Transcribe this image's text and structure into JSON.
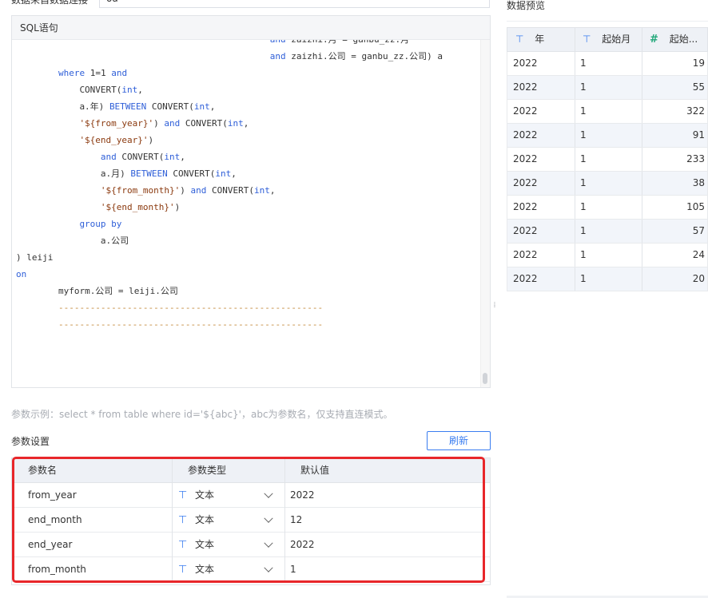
{
  "top_row": {
    "label": "数据来自数据连接",
    "selected_connection": "oa"
  },
  "sql_panel": {
    "title": "SQL语句",
    "lines": [
      {
        "indent": 48,
        "parts": [
          {
            "t": "and",
            "c": "kw"
          },
          {
            "t": " zaizhi.月 = ganbu_zz.月",
            "c": ""
          }
        ]
      },
      {
        "indent": 48,
        "parts": [
          {
            "t": "and",
            "c": "kw"
          },
          {
            "t": " zaizhi.公司 = ganbu_zz.公司) a",
            "c": ""
          }
        ]
      },
      {
        "indent": 8,
        "parts": [
          {
            "t": "where",
            "c": "kw"
          },
          {
            "t": " 1=1 ",
            "c": ""
          },
          {
            "t": "and",
            "c": "kw"
          }
        ]
      },
      {
        "indent": 12,
        "parts": [
          {
            "t": "CONVERT(",
            "c": ""
          },
          {
            "t": "int",
            "c": "kw"
          },
          {
            "t": ",",
            "c": ""
          }
        ]
      },
      {
        "indent": 12,
        "parts": [
          {
            "t": "a.年) ",
            "c": ""
          },
          {
            "t": "BETWEEN",
            "c": "kw"
          },
          {
            "t": " CONVERT(",
            "c": ""
          },
          {
            "t": "int",
            "c": "kw"
          },
          {
            "t": ",",
            "c": ""
          }
        ]
      },
      {
        "indent": 12,
        "parts": [
          {
            "t": "'${from_year}'",
            "c": "str"
          },
          {
            "t": ") ",
            "c": ""
          },
          {
            "t": "and",
            "c": "kw"
          },
          {
            "t": " CONVERT(",
            "c": ""
          },
          {
            "t": "int",
            "c": "kw"
          },
          {
            "t": ",",
            "c": ""
          }
        ]
      },
      {
        "indent": 12,
        "parts": [
          {
            "t": "'${end_year}'",
            "c": "str"
          },
          {
            "t": ")",
            "c": ""
          }
        ]
      },
      {
        "indent": 16,
        "parts": [
          {
            "t": "and",
            "c": "kw"
          },
          {
            "t": " CONVERT(",
            "c": ""
          },
          {
            "t": "int",
            "c": "kw"
          },
          {
            "t": ",",
            "c": ""
          }
        ]
      },
      {
        "indent": 16,
        "parts": [
          {
            "t": "a.月) ",
            "c": ""
          },
          {
            "t": "BETWEEN",
            "c": "kw"
          },
          {
            "t": " CONVERT(",
            "c": ""
          },
          {
            "t": "int",
            "c": "kw"
          },
          {
            "t": ",",
            "c": ""
          }
        ]
      },
      {
        "indent": 16,
        "parts": [
          {
            "t": "'${from_month}'",
            "c": "str"
          },
          {
            "t": ") ",
            "c": ""
          },
          {
            "t": "and",
            "c": "kw"
          },
          {
            "t": " CONVERT(",
            "c": ""
          },
          {
            "t": "int",
            "c": "kw"
          },
          {
            "t": ",",
            "c": ""
          }
        ]
      },
      {
        "indent": 16,
        "parts": [
          {
            "t": "'${end_month}'",
            "c": "str"
          },
          {
            "t": ")",
            "c": ""
          }
        ]
      },
      {
        "indent": 12,
        "parts": [
          {
            "t": "group by",
            "c": "kw"
          }
        ]
      },
      {
        "indent": 16,
        "parts": [
          {
            "t": "a.公司",
            "c": ""
          }
        ]
      },
      {
        "indent": 0,
        "parts": [
          {
            "t": ") leiji",
            "c": ""
          }
        ]
      },
      {
        "indent": 0,
        "parts": [
          {
            "t": "on",
            "c": "kw"
          }
        ]
      },
      {
        "indent": 8,
        "parts": [
          {
            "t": "myform.公司 = leiji.公司",
            "c": ""
          }
        ]
      },
      {
        "indent": 8,
        "parts": [
          {
            "t": "--------------------------------------------------",
            "c": "dash"
          }
        ]
      },
      {
        "indent": 8,
        "parts": [
          {
            "t": "--------------------------------------------------",
            "c": "dash"
          }
        ]
      }
    ]
  },
  "hint": "参数示例：select * from table where id='${abc}'，abc为参数名，仅支持直连模式。",
  "params": {
    "title": "参数设置",
    "refresh_label": "刷新",
    "headers": [
      "参数名",
      "参数类型",
      "默认值"
    ],
    "rows": [
      {
        "name": "from_year",
        "type": "文本",
        "default": "2022"
      },
      {
        "name": "end_month",
        "type": "文本",
        "default": "12"
      },
      {
        "name": "end_year",
        "type": "文本",
        "default": "2022"
      },
      {
        "name": "from_month",
        "type": "文本",
        "default": "1"
      }
    ],
    "highlight_color": "#e8262a"
  },
  "preview": {
    "title": "数据预览",
    "headers": [
      {
        "icon": "text-type-icon",
        "label": "年"
      },
      {
        "icon": "text-type-icon",
        "label": "起始月"
      },
      {
        "icon": "number-type-icon",
        "label": "起始..."
      }
    ],
    "rows": [
      [
        "2022",
        "1",
        "19"
      ],
      [
        "2022",
        "1",
        "55"
      ],
      [
        "2022",
        "1",
        "322"
      ],
      [
        "2022",
        "1",
        "91"
      ],
      [
        "2022",
        "1",
        "233"
      ],
      [
        "2022",
        "1",
        "38"
      ],
      [
        "2022",
        "1",
        "105"
      ],
      [
        "2022",
        "1",
        "57"
      ],
      [
        "2022",
        "1",
        "24"
      ],
      [
        "2022",
        "1",
        "20"
      ]
    ]
  },
  "colors": {
    "accent": "#3a7df0",
    "keyword": "#2f5fd8",
    "string": "#8b3a0f",
    "dashes": "#c38a3a",
    "number_icon": "#22a87a"
  }
}
